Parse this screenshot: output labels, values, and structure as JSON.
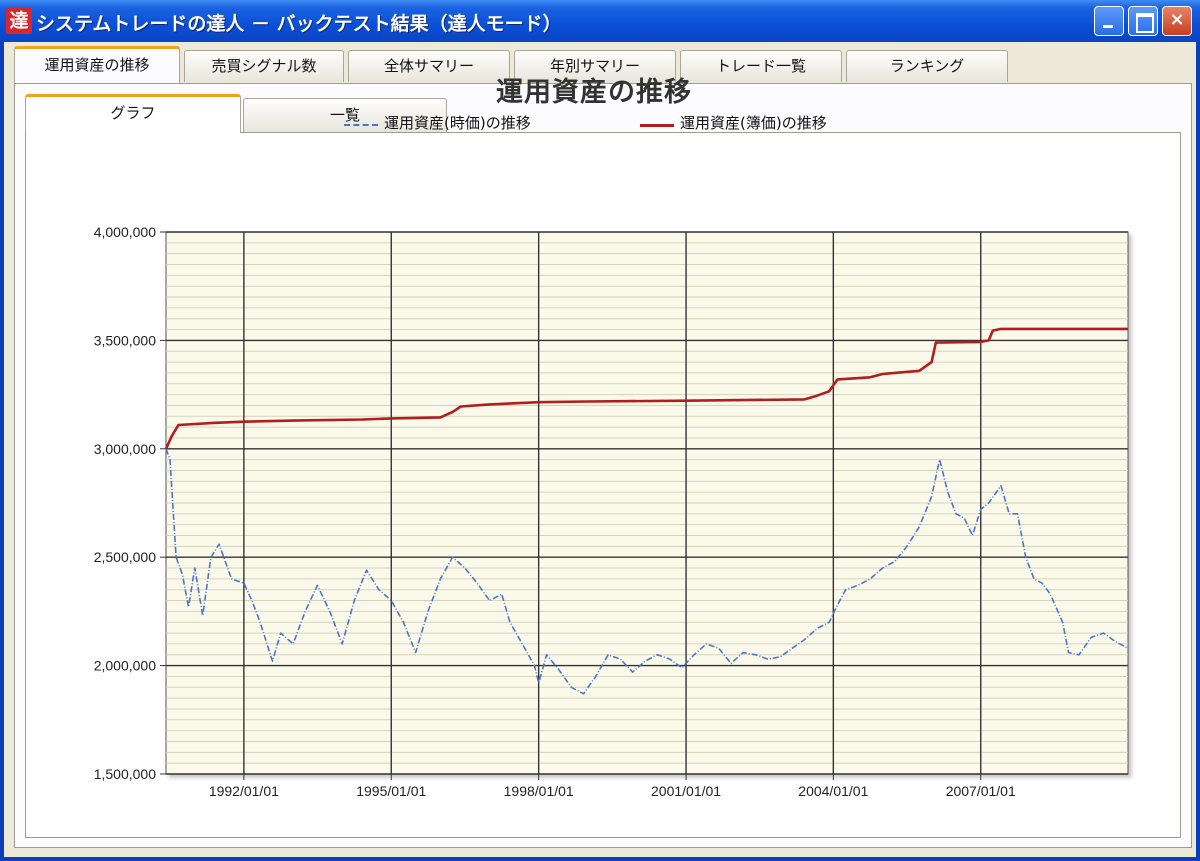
{
  "window": {
    "title": "システムトレードの達人 － バックテスト結果（達人モード）",
    "app_icon_glyph": "達",
    "controls": {
      "minimize": "minimize",
      "maximize": "maximize",
      "close": "×"
    }
  },
  "tabs": [
    {
      "label": "運用資産の推移",
      "active": true
    },
    {
      "label": "売買シグナル数",
      "active": false
    },
    {
      "label": "全体サマリー",
      "active": false
    },
    {
      "label": "年別サマリー",
      "active": false
    },
    {
      "label": "トレード一覧",
      "active": false
    },
    {
      "label": "ランキング",
      "active": false
    }
  ],
  "subtabs": [
    {
      "label": "グラフ",
      "active": true
    },
    {
      "label": "一覧",
      "active": false
    }
  ],
  "colors": {
    "plot_background": "#fbf9ea",
    "market_series": "#4a76c9",
    "book_series": "#b01e1e",
    "title_bar": "#0b4fd6",
    "active_tab_accent": "#f2a21b"
  },
  "chart_data": {
    "type": "line",
    "title": "運用資産の推移",
    "xlabel": "",
    "ylabel": "",
    "ylim": [
      1500000,
      4000000
    ],
    "xlim": [
      "1990/06/01",
      "2009/12/31"
    ],
    "y_ticks": [
      {
        "value": 4000000,
        "label": "4,000,000"
      },
      {
        "value": 3500000,
        "label": "3,500,000"
      },
      {
        "value": 3000000,
        "label": "3,000,000"
      },
      {
        "value": 2500000,
        "label": "2,500,000"
      },
      {
        "value": 2000000,
        "label": "2,000,000"
      },
      {
        "value": 1500000,
        "label": "1,500,000"
      }
    ],
    "x_ticks": [
      {
        "value": "1992/01/01",
        "label": "1992/01/01"
      },
      {
        "value": "1995/01/01",
        "label": "1995/01/01"
      },
      {
        "value": "1998/01/01",
        "label": "1998/01/01"
      },
      {
        "value": "2001/01/01",
        "label": "2001/01/01"
      },
      {
        "value": "2004/01/01",
        "label": "2004/01/01"
      },
      {
        "value": "2007/01/01",
        "label": "2007/01/01"
      }
    ],
    "grid": true,
    "legend_position": "top-center",
    "series": [
      {
        "name": "運用資産(時価)の推移",
        "style": "dash-dot",
        "points": [
          [
            "1990/06/01",
            3000000
          ],
          [
            "1990/07/01",
            2950000
          ],
          [
            "1990/08/15",
            2500000
          ],
          [
            "1990/10/01",
            2420000
          ],
          [
            "1990/11/15",
            2270000
          ],
          [
            "1991/01/01",
            2450000
          ],
          [
            "1991/03/01",
            2230000
          ],
          [
            "1991/05/01",
            2500000
          ],
          [
            "1991/07/01",
            2560000
          ],
          [
            "1991/10/01",
            2400000
          ],
          [
            "1992/01/01",
            2380000
          ],
          [
            "1992/03/01",
            2300000
          ],
          [
            "1992/05/01",
            2200000
          ],
          [
            "1992/08/01",
            2020000
          ],
          [
            "1992/10/01",
            2150000
          ],
          [
            "1993/01/01",
            2100000
          ],
          [
            "1993/04/01",
            2250000
          ],
          [
            "1993/07/01",
            2370000
          ],
          [
            "1993/10/01",
            2250000
          ],
          [
            "1994/01/01",
            2100000
          ],
          [
            "1994/04/01",
            2300000
          ],
          [
            "1994/07/01",
            2440000
          ],
          [
            "1994/10/01",
            2350000
          ],
          [
            "1995/01/01",
            2300000
          ],
          [
            "1995/04/01",
            2200000
          ],
          [
            "1995/07/01",
            2060000
          ],
          [
            "1995/10/01",
            2250000
          ],
          [
            "1996/01/01",
            2400000
          ],
          [
            "1996/04/01",
            2500000
          ],
          [
            "1996/07/01",
            2450000
          ],
          [
            "1996/10/01",
            2380000
          ],
          [
            "1997/01/01",
            2300000
          ],
          [
            "1997/04/01",
            2330000
          ],
          [
            "1997/06/01",
            2200000
          ],
          [
            "1997/09/01",
            2100000
          ],
          [
            "1997/12/01",
            2000000
          ],
          [
            "1998/01/01",
            1920000
          ],
          [
            "1998/03/01",
            2050000
          ],
          [
            "1998/06/01",
            1980000
          ],
          [
            "1998/09/01",
            1900000
          ],
          [
            "1998/12/01",
            1870000
          ],
          [
            "1999/03/01",
            1950000
          ],
          [
            "1999/06/01",
            2050000
          ],
          [
            "1999/09/01",
            2030000
          ],
          [
            "1999/12/01",
            1970000
          ],
          [
            "2000/03/01",
            2020000
          ],
          [
            "2000/06/01",
            2050000
          ],
          [
            "2000/09/01",
            2030000
          ],
          [
            "2000/12/01",
            1990000
          ],
          [
            "2001/03/01",
            2050000
          ],
          [
            "2001/06/01",
            2100000
          ],
          [
            "2001/09/01",
            2080000
          ],
          [
            "2001/12/01",
            2010000
          ],
          [
            "2002/03/01",
            2060000
          ],
          [
            "2002/06/01",
            2050000
          ],
          [
            "2002/09/01",
            2030000
          ],
          [
            "2002/12/01",
            2040000
          ],
          [
            "2003/03/01",
            2080000
          ],
          [
            "2003/06/01",
            2120000
          ],
          [
            "2003/09/01",
            2170000
          ],
          [
            "2003/12/01",
            2200000
          ],
          [
            "2004/02/01",
            2280000
          ],
          [
            "2004/04/01",
            2350000
          ],
          [
            "2004/07/01",
            2370000
          ],
          [
            "2004/10/01",
            2400000
          ],
          [
            "2005/01/01",
            2450000
          ],
          [
            "2005/04/01",
            2480000
          ],
          [
            "2005/07/01",
            2550000
          ],
          [
            "2005/10/01",
            2640000
          ],
          [
            "2006/01/01",
            2780000
          ],
          [
            "2006/03/01",
            2950000
          ],
          [
            "2006/05/01",
            2800000
          ],
          [
            "2006/07/01",
            2700000
          ],
          [
            "2006/09/01",
            2680000
          ],
          [
            "2006/11/01",
            2600000
          ],
          [
            "2007/01/01",
            2720000
          ],
          [
            "2007/03/01",
            2750000
          ],
          [
            "2007/06/01",
            2830000
          ],
          [
            "2007/08/01",
            2700000
          ],
          [
            "2007/10/01",
            2700000
          ],
          [
            "2007/12/01",
            2500000
          ],
          [
            "2008/02/01",
            2400000
          ],
          [
            "2008/04/01",
            2380000
          ],
          [
            "2008/06/01",
            2330000
          ],
          [
            "2008/09/01",
            2200000
          ],
          [
            "2008/10/15",
            2060000
          ],
          [
            "2009/01/01",
            2050000
          ],
          [
            "2009/04/01",
            2130000
          ],
          [
            "2009/07/01",
            2150000
          ],
          [
            "2009/10/01",
            2110000
          ],
          [
            "2009/12/31",
            2080000
          ]
        ]
      },
      {
        "name": "運用資産(簿価)の推移",
        "style": "solid",
        "points": [
          [
            "1990/06/01",
            3000000
          ],
          [
            "1990/07/15",
            3060000
          ],
          [
            "1990/09/01",
            3110000
          ],
          [
            "1991/06/01",
            3120000
          ],
          [
            "1992/01/01",
            3125000
          ],
          [
            "1993/01/01",
            3130000
          ],
          [
            "1994/06/01",
            3135000
          ],
          [
            "1995/01/01",
            3140000
          ],
          [
            "1996/01/01",
            3145000
          ],
          [
            "1996/04/01",
            3170000
          ],
          [
            "1996/06/01",
            3195000
          ],
          [
            "1997/01/01",
            3205000
          ],
          [
            "1998/01/01",
            3215000
          ],
          [
            "1999/01/01",
            3218000
          ],
          [
            "2001/01/01",
            3222000
          ],
          [
            "2003/06/01",
            3228000
          ],
          [
            "2003/09/01",
            3245000
          ],
          [
            "2003/12/01",
            3265000
          ],
          [
            "2004/02/01",
            3320000
          ],
          [
            "2004/10/01",
            3330000
          ],
          [
            "2005/01/01",
            3345000
          ],
          [
            "2005/10/01",
            3360000
          ],
          [
            "2006/01/01",
            3400000
          ],
          [
            "2006/02/01",
            3490000
          ],
          [
            "2007/01/01",
            3493000
          ],
          [
            "2007/03/01",
            3500000
          ],
          [
            "2007/04/01",
            3545000
          ],
          [
            "2007/06/01",
            3553000
          ],
          [
            "2009/12/31",
            3553000
          ]
        ]
      }
    ]
  }
}
